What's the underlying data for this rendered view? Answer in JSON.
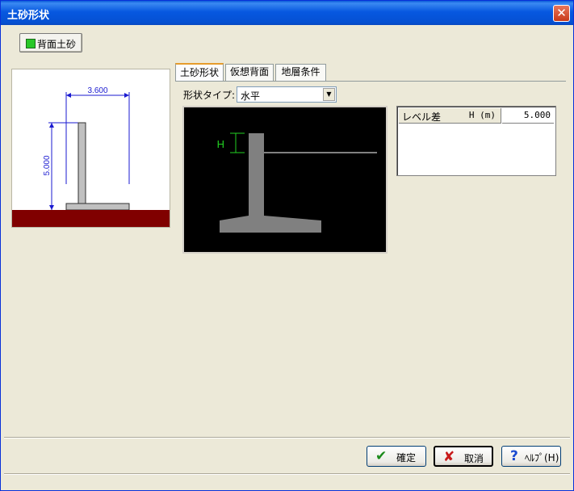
{
  "window": {
    "title": "土砂形状",
    "close_glyph": "✕"
  },
  "layer_button": {
    "label": "背面土砂",
    "color": "#28c828"
  },
  "preview": {
    "dim_width": "3.600",
    "dim_height": "5.000",
    "ground_color": "#800000"
  },
  "tabs": [
    {
      "label": "土砂形状",
      "active": true
    },
    {
      "label": "仮想背面",
      "active": false
    },
    {
      "label": "地層条件",
      "active": false
    }
  ],
  "shape_type": {
    "label": "形状タイプ:",
    "value": "水平",
    "arrow": "▼"
  },
  "diagram": {
    "h_label": "H"
  },
  "grid": {
    "col_name": "レベル差",
    "col_unit": "H (m)",
    "value": "5.000"
  },
  "buttons": {
    "ok": {
      "label": "確定",
      "icon": "✔"
    },
    "cancel": {
      "label": "取消",
      "icon": "✘"
    },
    "help": {
      "label": "ﾍﾙﾌﾟ(H)",
      "icon": "?"
    }
  }
}
